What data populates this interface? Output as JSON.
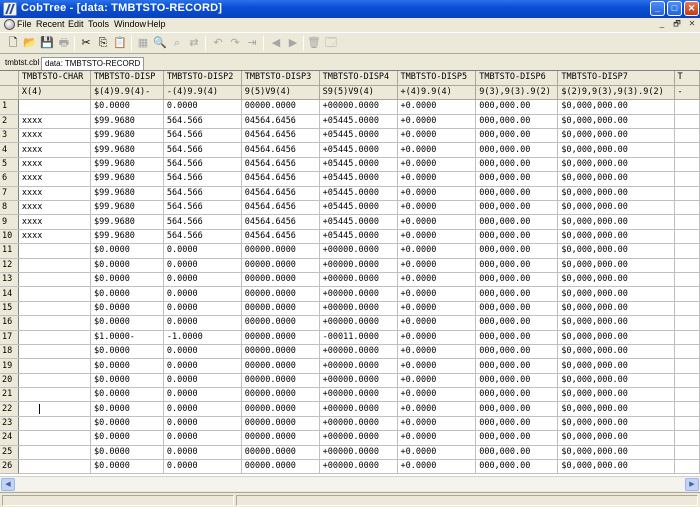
{
  "window": {
    "title": "CobTree - [data: TMBTSTO-RECORD]",
    "controls": {
      "minimize": "_",
      "maximize": "□",
      "close": "✕"
    }
  },
  "menu": {
    "items": [
      "File",
      "Recent",
      "Edit",
      "Tools",
      "Window",
      "Help"
    ],
    "mdi_controls": [
      "_",
      "🗗",
      "✕"
    ]
  },
  "toolbar": {
    "buttons": [
      {
        "name": "new-file-icon",
        "glyph": "🗋",
        "enabled": true
      },
      {
        "name": "open-folder-icon",
        "glyph": "📂",
        "enabled": true
      },
      {
        "name": "save-icon",
        "glyph": "💾",
        "enabled": true
      },
      {
        "name": "print-icon",
        "glyph": "🖶",
        "enabled": false
      },
      {
        "name": "cut-icon",
        "glyph": "✂",
        "enabled": true
      },
      {
        "name": "copy-icon",
        "glyph": "⎘",
        "enabled": true
      },
      {
        "name": "paste-icon",
        "glyph": "📋",
        "enabled": true
      },
      {
        "name": "grid-icon",
        "glyph": "▦",
        "enabled": false
      },
      {
        "name": "find-icon",
        "glyph": "🔍",
        "enabled": false
      },
      {
        "name": "find-next-icon",
        "glyph": "⌕",
        "enabled": false
      },
      {
        "name": "replace-icon",
        "glyph": "⇄",
        "enabled": false
      },
      {
        "name": "undo-icon",
        "glyph": "↶",
        "enabled": false
      },
      {
        "name": "redo-icon",
        "glyph": "↷",
        "enabled": false
      },
      {
        "name": "goto-icon",
        "glyph": "⇥",
        "enabled": false
      },
      {
        "name": "back-arrow-icon",
        "glyph": "◀",
        "enabled": false
      },
      {
        "name": "forward-arrow-icon",
        "glyph": "▶",
        "enabled": false
      },
      {
        "name": "delete-icon",
        "glyph": "🗑",
        "enabled": false
      },
      {
        "name": "properties-icon",
        "glyph": "🗔",
        "enabled": false
      }
    ]
  },
  "tabs": [
    {
      "label": "tmbtst.cbl",
      "active": false
    },
    {
      "label": "data: TMBTSTO-RECORD",
      "active": true
    }
  ],
  "grid": {
    "columns": [
      {
        "name": "TMBTSTO-CHAR",
        "pic": "X(4)"
      },
      {
        "name": "TMBTSTO-DISP",
        "pic": "$(4)9.9(4)-"
      },
      {
        "name": "TMBTSTO-DISP2",
        "pic": "-(4)9.9(4)"
      },
      {
        "name": "TMBTSTO-DISP3",
        "pic": "9(5)V9(4)"
      },
      {
        "name": "TMBTSTO-DISP4",
        "pic": "S9(5)V9(4)"
      },
      {
        "name": "TMBTSTO-DISP5",
        "pic": "+(4)9.9(4)"
      },
      {
        "name": "TMBTSTO-DISP6",
        "pic": "9(3),9(3).9(2)"
      },
      {
        "name": "TMBTSTO-DISP7",
        "pic": "$(2)9,9(3),9(3).9(2)"
      },
      {
        "name": "T",
        "pic": "-"
      }
    ],
    "rows": [
      [
        "1",
        "",
        "$0.0000",
        "0.0000",
        "00000.0000",
        "+00000.0000",
        "+0.0000",
        "000,000.00",
        "$0,000,000.00",
        ""
      ],
      [
        "2",
        "xxxx",
        "$99.9680",
        "564.566",
        "04564.6456",
        "+05445.0000",
        "+0.0000",
        "000,000.00",
        "$0,000,000.00",
        ""
      ],
      [
        "3",
        "xxxx",
        "$99.9680",
        "564.566",
        "04564.6456",
        "+05445.0000",
        "+0.0000",
        "000,000.00",
        "$0,000,000.00",
        ""
      ],
      [
        "4",
        "xxxx",
        "$99.9680",
        "564.566",
        "04564.6456",
        "+05445.0000",
        "+0.0000",
        "000,000.00",
        "$0,000,000.00",
        ""
      ],
      [
        "5",
        "xxxx",
        "$99.9680",
        "564.566",
        "04564.6456",
        "+05445.0000",
        "+0.0000",
        "000,000.00",
        "$0,000,000.00",
        ""
      ],
      [
        "6",
        "xxxx",
        "$99.9680",
        "564.566",
        "04564.6456",
        "+05445.0000",
        "+0.0000",
        "000,000.00",
        "$0,000,000.00",
        ""
      ],
      [
        "7",
        "xxxx",
        "$99.9680",
        "564.566",
        "04564.6456",
        "+05445.0000",
        "+0.0000",
        "000,000.00",
        "$0,000,000.00",
        ""
      ],
      [
        "8",
        "xxxx",
        "$99.9680",
        "564.566",
        "04564.6456",
        "+05445.0000",
        "+0.0000",
        "000,000.00",
        "$0,000,000.00",
        ""
      ],
      [
        "9",
        "xxxx",
        "$99.9680",
        "564.566",
        "04564.6456",
        "+05445.0000",
        "+0.0000",
        "000,000.00",
        "$0,000,000.00",
        ""
      ],
      [
        "10",
        "xxxx",
        "$99.9680",
        "564.566",
        "04564.6456",
        "+05445.0000",
        "+0.0000",
        "000,000.00",
        "$0,000,000.00",
        ""
      ],
      [
        "11",
        "",
        "$0.0000",
        "0.0000",
        "00000.0000",
        "+00000.0000",
        "+0.0000",
        "000,000.00",
        "$0,000,000.00",
        ""
      ],
      [
        "12",
        "",
        "$0.0000",
        "0.0000",
        "00000.0000",
        "+00000.0000",
        "+0.0000",
        "000,000.00",
        "$0,000,000.00",
        ""
      ],
      [
        "13",
        "",
        "$0.0000",
        "0.0000",
        "00000.0000",
        "+00000.0000",
        "+0.0000",
        "000,000.00",
        "$0,000,000.00",
        ""
      ],
      [
        "14",
        "",
        "$0.0000",
        "0.0000",
        "00000.0000",
        "+00000.0000",
        "+0.0000",
        "000,000.00",
        "$0,000,000.00",
        ""
      ],
      [
        "15",
        "",
        "$0.0000",
        "0.0000",
        "00000.0000",
        "+00000.0000",
        "+0.0000",
        "000,000.00",
        "$0,000,000.00",
        ""
      ],
      [
        "16",
        "",
        "$0.0000",
        "0.0000",
        "00000.0000",
        "+00000.0000",
        "+0.0000",
        "000,000.00",
        "$0,000,000.00",
        ""
      ],
      [
        "17",
        "",
        "$1.0000-",
        "-1.0000",
        "00000.0000",
        "-00011.0000",
        "+0.0000",
        "000,000.00",
        "$0,000,000.00",
        ""
      ],
      [
        "18",
        "",
        "$0.0000",
        "0.0000",
        "00000.0000",
        "+00000.0000",
        "+0.0000",
        "000,000.00",
        "$0,000,000.00",
        ""
      ],
      [
        "19",
        "",
        "$0.0000",
        "0.0000",
        "00000.0000",
        "+00000.0000",
        "+0.0000",
        "000,000.00",
        "$0,000,000.00",
        ""
      ],
      [
        "20",
        "",
        "$0.0000",
        "0.0000",
        "00000.0000",
        "+00000.0000",
        "+0.0000",
        "000,000.00",
        "$0,000,000.00",
        ""
      ],
      [
        "21",
        "",
        "$0.0000",
        "0.0000",
        "00000.0000",
        "+00000.0000",
        "+0.0000",
        "000,000.00",
        "$0,000,000.00",
        ""
      ],
      [
        "22",
        "",
        "$0.0000",
        "0.0000",
        "00000.0000",
        "+00000.0000",
        "+0.0000",
        "000,000.00",
        "$0,000,000.00",
        ""
      ],
      [
        "23",
        "",
        "$0.0000",
        "0.0000",
        "00000.0000",
        "+00000.0000",
        "+0.0000",
        "000,000.00",
        "$0,000,000.00",
        ""
      ],
      [
        "24",
        "",
        "$0.0000",
        "0.0000",
        "00000.0000",
        "+00000.0000",
        "+0.0000",
        "000,000.00",
        "$0,000,000.00",
        ""
      ],
      [
        "25",
        "",
        "$0.0000",
        "0.0000",
        "00000.0000",
        "+00000.0000",
        "+0.0000",
        "000,000.00",
        "$0,000,000.00",
        ""
      ],
      [
        "26",
        "",
        "$0.0000",
        "0.0000",
        "00000.0000",
        "+00000.0000",
        "+0.0000",
        "000,000.00",
        "$0,000,000.00",
        ""
      ]
    ],
    "cursor_row": "22"
  },
  "scrollbar": {
    "left_arrow": "◀",
    "right_arrow": "▶"
  },
  "colors": {
    "titlebar": "#0a4fd4",
    "chrome": "#ece9d8",
    "grid_line": "#c0c0c0"
  }
}
